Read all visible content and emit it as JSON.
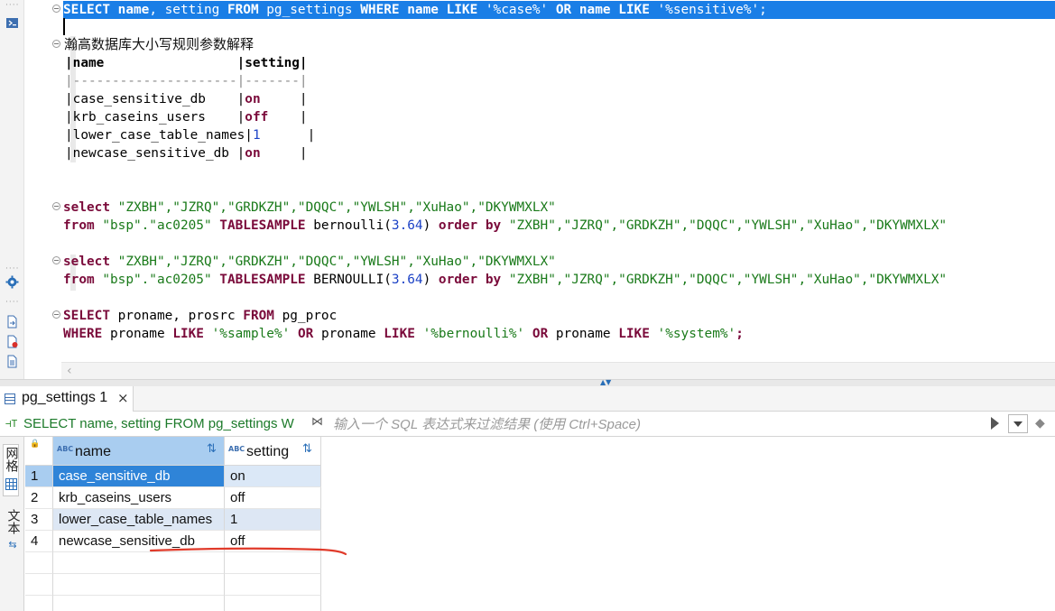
{
  "editor": {
    "selected_line": {
      "tokens": [
        {
          "t": "SELECT",
          "k": "kw"
        },
        {
          "t": " ",
          "k": "plain"
        },
        {
          "t": "name",
          "k": "kw"
        },
        {
          "t": ", setting ",
          "k": "plain"
        },
        {
          "t": "FROM",
          "k": "kw"
        },
        {
          "t": " pg_settings ",
          "k": "plain"
        },
        {
          "t": "WHERE",
          "k": "kw"
        },
        {
          "t": " ",
          "k": "plain"
        },
        {
          "t": "name",
          "k": "kw"
        },
        {
          "t": " ",
          "k": "plain"
        },
        {
          "t": "LIKE",
          "k": "kw"
        },
        {
          "t": " '%case%' ",
          "k": "plain"
        },
        {
          "t": "OR",
          "k": "kw"
        },
        {
          "t": " ",
          "k": "plain"
        },
        {
          "t": "name",
          "k": "kw"
        },
        {
          "t": " ",
          "k": "plain"
        },
        {
          "t": "LIKE",
          "k": "kw"
        },
        {
          "t": " '%sensitive%';",
          "k": "plain"
        }
      ]
    },
    "comment": "瀚高数据库大小写规则参数解释",
    "text_table": {
      "header": "|name                 |setting|",
      "divider": "|---------------------|-------|",
      "rows": [
        {
          "name": "|case_sensitive_db    |",
          "value": "on",
          "cls": "on",
          "pad": "     |"
        },
        {
          "name": "|krb_caseins_users    |",
          "value": "off",
          "cls": "on",
          "pad": "    |"
        },
        {
          "name": "|lower_case_table_names|",
          "value": "1",
          "cls": "n1",
          "pad": "      |"
        },
        {
          "name": "|newcase_sensitive_db |",
          "value": "on",
          "cls": "on",
          "pad": "     |"
        }
      ]
    },
    "statements": [
      [
        [
          {
            "t": "select",
            "k": "kw"
          },
          {
            "t": " ",
            "k": "plain"
          },
          {
            "t": "\"ZXBH\",\"JZRQ\",\"GRDKZH\",\"DQQC\",\"YWLSH\",\"XuHao\",\"DKYWMXLX\"",
            "k": "str"
          }
        ],
        [
          {
            "t": "from",
            "k": "kw"
          },
          {
            "t": " ",
            "k": "plain"
          },
          {
            "t": "\"bsp\".\"ac0205\"",
            "k": "str"
          },
          {
            "t": " ",
            "k": "plain"
          },
          {
            "t": "TABLESAMPLE",
            "k": "kw"
          },
          {
            "t": " bernoulli(",
            "k": "plain"
          },
          {
            "t": "3.64",
            "k": "num"
          },
          {
            "t": ") ",
            "k": "plain"
          },
          {
            "t": "order by",
            "k": "kw"
          },
          {
            "t": " ",
            "k": "plain"
          },
          {
            "t": "\"ZXBH\",\"JZRQ\",\"GRDKZH\",\"DQQC\",\"YWLSH\",\"XuHao\",\"DKYWMXLX\"",
            "k": "str"
          }
        ]
      ],
      [
        [
          {
            "t": "select",
            "k": "kw"
          },
          {
            "t": " ",
            "k": "plain"
          },
          {
            "t": "\"ZXBH\",\"JZRQ\",\"GRDKZH\",\"DQQC\",\"YWLSH\",\"XuHao\",\"DKYWMXLX\"",
            "k": "str"
          }
        ],
        [
          {
            "t": "from",
            "k": "kw"
          },
          {
            "t": " ",
            "k": "plain"
          },
          {
            "t": "\"bsp\".\"ac0205\"",
            "k": "str"
          },
          {
            "t": " ",
            "k": "plain"
          },
          {
            "t": "TABLESAMPLE",
            "k": "kw"
          },
          {
            "t": " BERNOULLI(",
            "k": "plain"
          },
          {
            "t": "3.64",
            "k": "num"
          },
          {
            "t": ") ",
            "k": "plain"
          },
          {
            "t": "order by",
            "k": "kw"
          },
          {
            "t": " ",
            "k": "plain"
          },
          {
            "t": "\"ZXBH\",\"JZRQ\",\"GRDKZH\",\"DQQC\",\"YWLSH\",\"XuHao\",\"DKYWMXLX\"",
            "k": "str"
          }
        ]
      ],
      [
        [
          {
            "t": "SELECT",
            "k": "kw"
          },
          {
            "t": " proname, prosrc ",
            "k": "plain"
          },
          {
            "t": "FROM",
            "k": "kw"
          },
          {
            "t": " pg_proc",
            "k": "plain"
          }
        ],
        [
          {
            "t": "WHERE",
            "k": "kw"
          },
          {
            "t": " proname ",
            "k": "plain"
          },
          {
            "t": "LIKE",
            "k": "kw"
          },
          {
            "t": " ",
            "k": "plain"
          },
          {
            "t": "'%sample%'",
            "k": "str"
          },
          {
            "t": " ",
            "k": "plain"
          },
          {
            "t": "OR",
            "k": "kw"
          },
          {
            "t": " proname ",
            "k": "plain"
          },
          {
            "t": "LIKE",
            "k": "kw"
          },
          {
            "t": " ",
            "k": "plain"
          },
          {
            "t": "'%bernoulli%'",
            "k": "str"
          },
          {
            "t": " ",
            "k": "plain"
          },
          {
            "t": "OR",
            "k": "kw"
          },
          {
            "t": " proname ",
            "k": "plain"
          },
          {
            "t": "LIKE",
            "k": "kw"
          },
          {
            "t": " ",
            "k": "plain"
          },
          {
            "t": "'%system%'",
            "k": "str"
          },
          {
            "t": ";",
            "k": "kw"
          }
        ]
      ]
    ]
  },
  "results": {
    "tab_label": "pg_settings 1",
    "tab_close": "×",
    "query_text": "SELECT name, setting FROM pg_settings W",
    "filter_placeholder": "输入一个 SQL 表达式来过滤结果 (使用 Ctrl+Space)",
    "side_tabs": {
      "grid": "网格",
      "text": "文本"
    },
    "columns": [
      {
        "title": "name",
        "type_badge": "ABC"
      },
      {
        "title": "setting",
        "type_badge": "ABC"
      }
    ],
    "rows": [
      {
        "num": "1",
        "name": "case_sensitive_db",
        "setting": "on"
      },
      {
        "num": "2",
        "name": "krb_caseins_users",
        "setting": "off"
      },
      {
        "num": "3",
        "name": "lower_case_table_names",
        "setting": "1"
      },
      {
        "num": "4",
        "name": "newcase_sensitive_db",
        "setting": "off"
      }
    ]
  },
  "colors": {
    "selection": "#1a7ee6",
    "keyword": "#7a0a3a",
    "string": "#1a7a1a",
    "number": "#1d43c6",
    "annotation": "#e03a2a"
  }
}
